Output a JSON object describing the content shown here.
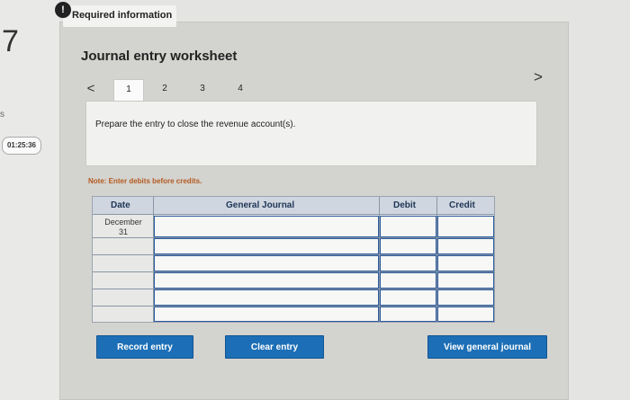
{
  "question": {
    "number": "7",
    "side_letter": "s",
    "timer": "01:25:36"
  },
  "banner": {
    "badge": "!",
    "label": "Required information"
  },
  "worksheet": {
    "title": "Journal entry worksheet",
    "nav_prev": "<",
    "nav_next": ">",
    "tabs": [
      {
        "label": "1",
        "active": true
      },
      {
        "label": "2",
        "active": false
      },
      {
        "label": "3",
        "active": false
      },
      {
        "label": "4",
        "active": false
      }
    ],
    "instruction": "Prepare the entry to close the revenue account(s).",
    "note": "Note: Enter debits before credits."
  },
  "table": {
    "headers": {
      "date": "Date",
      "journal": "General Journal",
      "debit": "Debit",
      "credit": "Credit"
    },
    "date_month": "December",
    "date_day": "31"
  },
  "buttons": {
    "record": "Record entry",
    "clear": "Clear entry",
    "view": "View general journal"
  },
  "colors": {
    "button": "#1c6fb6",
    "note": "#b45a1e",
    "header": "#cfd6df"
  }
}
